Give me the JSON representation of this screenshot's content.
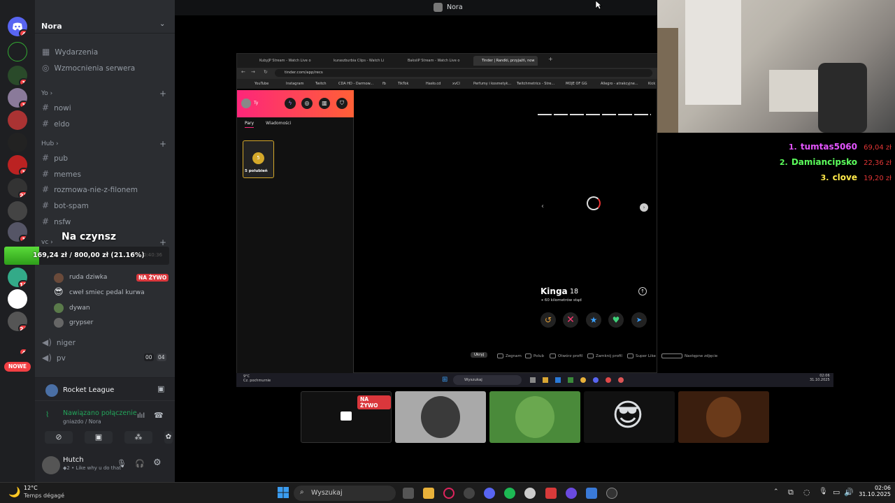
{
  "title_bar": {
    "title": "Nora"
  },
  "server_rail": {
    "badges": [
      "4",
      "1",
      "1",
      "1",
      "21",
      "1",
      "12",
      "24",
      "4"
    ],
    "new_label": "NOWE"
  },
  "server": {
    "name": "Nora"
  },
  "channels": {
    "top": [
      {
        "label": "Wydarzenia"
      },
      {
        "label": "Wzmocnienia serwera"
      }
    ],
    "categories": [
      {
        "name": "Yo",
        "channels": [
          "nowi",
          "eldo"
        ]
      },
      {
        "name": "Hub",
        "channels": [
          "pub",
          "memes",
          "rozmowa-nie-z-filonem",
          "bot-spam",
          "nsfw"
        ]
      }
    ],
    "vc_label": "vc",
    "voice_users": [
      {
        "name": "ruda dziwka",
        "live": "NA ŻYWO"
      },
      {
        "name": "cweł smiec pedal kurwa"
      },
      {
        "name": "dywan"
      },
      {
        "name": "grypser"
      }
    ],
    "voice_channels": [
      {
        "label": "niger"
      },
      {
        "label": "pv",
        "count_a": "00",
        "count_b": "04"
      }
    ]
  },
  "donation_overlay": {
    "title": "Na czynsz",
    "progress_text": "169,24 zł / 800,00 zł (21.16%)",
    "progress_fraction": 0.2116,
    "timer": "0:40:36"
  },
  "activity": {
    "game": "Rocket League"
  },
  "voice_status": {
    "status": "Nawiązano połączenie",
    "location": "gniazdo / Nora"
  },
  "user": {
    "name": "Hutch",
    "status": "Like why u do that",
    "status_count": "2"
  },
  "browser": {
    "tabs": [
      "KubyJP Stream - Watch Live o",
      "kuraszburbia Clips - Watch Li",
      "BaksiiP Stream - Watch Live o",
      "Tinder | Randki, przyjaźń, now"
    ],
    "url": "tinder.com/app/recs",
    "bookmarks": [
      "YouTube",
      "Instagram",
      "Twitch",
      "CDA HD - Darmow...",
      "fb",
      "TikTok",
      "Hasło.cd",
      "xvCl",
      "Perfumy i kosmetyk...",
      "Twitchmetrics - Stre...",
      "MOJE OF GG",
      "Allegro - atrakcyjne...",
      "Kick"
    ],
    "tinder": {
      "profile_label": "Ty",
      "tab_matches": "Pary",
      "tab_messages": "Wiadomości",
      "likes_count": "5",
      "likes_label": "5 polubień",
      "card_name": "Kinga",
      "card_age": "18",
      "card_distance": "60 kilometrów stąd",
      "hints": [
        "Ukryj",
        "Zegnam",
        "Polub",
        "Otwórz profil",
        "Zamknij profil",
        "Super Like",
        "Następne zdjęcie"
      ]
    },
    "inner_taskbar": {
      "weather_temp": "9°C",
      "weather_desc": "Cz. pochmurnie",
      "search": "Wyszukaj",
      "time": "02:06",
      "date": "31.10.2025"
    }
  },
  "leaderboard": [
    {
      "rank": "1.",
      "name": "tumtas5060",
      "amount": "69,04 zł",
      "color": "#e455ff"
    },
    {
      "rank": "2.",
      "name": "Damiancipsko",
      "amount": "22,36 zł",
      "color": "#5cff5c"
    },
    {
      "rank": "3.",
      "name": "clove",
      "amount": "19,20 zł",
      "color": "#ffe94a"
    }
  ],
  "participants": {
    "live_label": "NA ŻYWO"
  },
  "taskbar": {
    "weather_temp": "12°C",
    "weather_desc": "Temps dégagé",
    "search": "Wyszukaj",
    "time": "02:06",
    "date": "31.10.2025"
  }
}
